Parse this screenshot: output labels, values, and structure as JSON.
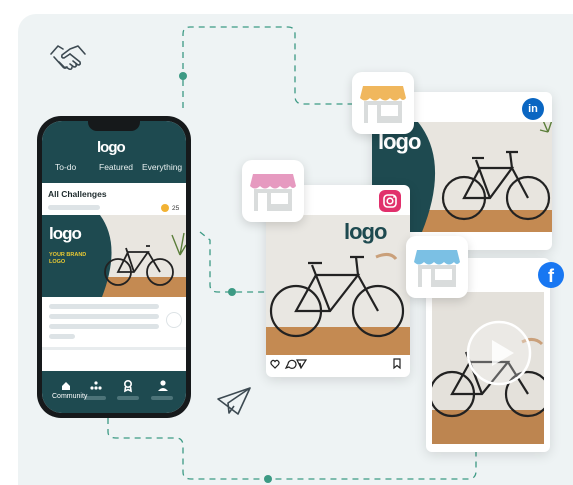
{
  "phone": {
    "logo": "logo",
    "tabs": [
      "To-do",
      "Featured",
      "Everything"
    ],
    "section_title": "All Challenges",
    "coin_count": "25",
    "banner_logo": "logo",
    "banner_text_line1": "YOUR BRAND",
    "banner_text_line2": "LOGO",
    "nav_label": "Community"
  },
  "cards": {
    "linkedin": {
      "logo": "logo",
      "network": "in"
    },
    "instagram": {
      "logo": "logo"
    },
    "facebook": {
      "network": "f"
    }
  },
  "icons": {
    "handshake": "handshake-icon",
    "paper_plane": "paper-plane-icon",
    "heart": "heart-icon",
    "comment": "comment-icon",
    "send": "send-icon",
    "bookmark": "bookmark-icon",
    "play": "play-icon"
  },
  "colors": {
    "brand_teal": "#1e4a50",
    "dashed_line": "#3c9a84",
    "awning_orange": "#f0b75d",
    "awning_pink": "#e69ac0",
    "awning_blue": "#7bc0e4",
    "linkedin": "#0a66c2",
    "instagram": "#e1306c",
    "facebook": "#1877f2"
  }
}
